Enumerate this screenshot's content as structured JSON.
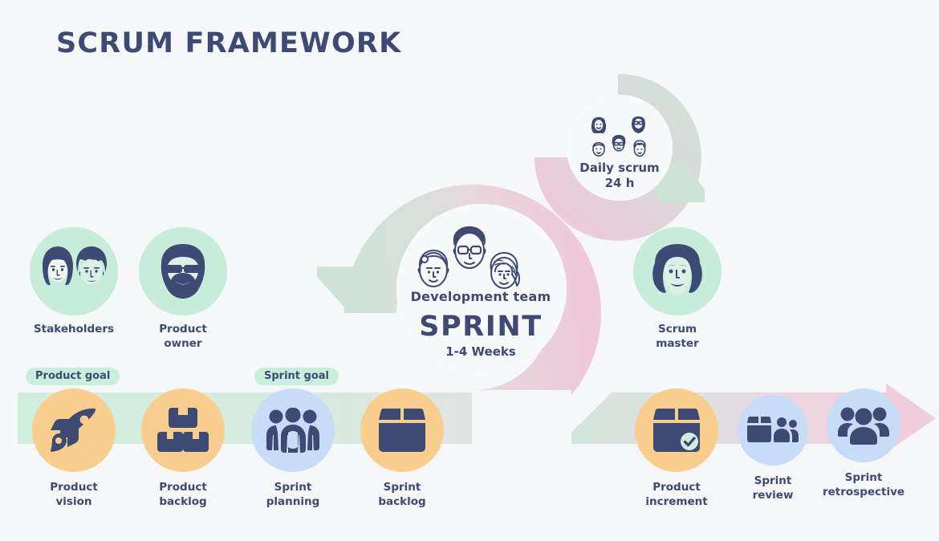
{
  "page": {
    "title": "SCRUM FRAMEWORK",
    "background_color": "#f6f7f9",
    "ink_color": "#3d4a73"
  },
  "palette": {
    "navy": "#3d4a73",
    "mint": "#c7ecd9",
    "mint_band": "#cfeede",
    "mint_badge": "#c8eedc",
    "orange": "#f8cd8d",
    "blue": "#c6dcf7",
    "pink": "#f0cddb",
    "pink_ring": "#efcbd9",
    "mint_ring": "#cfe2d7",
    "white": "#f8f9fa"
  },
  "roles": [
    {
      "id": "stakeholders",
      "label": "Stakeholders",
      "icon": "two-faces-icon",
      "circle_color": "#c7ecd9"
    },
    {
      "id": "product-owner",
      "label": "Product\nowner",
      "icon": "bearded-face-icon",
      "circle_color": "#c7ecd9"
    },
    {
      "id": "scrum-master",
      "label": "Scrum\nmaster",
      "icon": "woman-face-icon",
      "circle_color": "#c7ecd9"
    }
  ],
  "center": {
    "team_label": "Development team",
    "sprint_label": "SPRINT",
    "duration_label": "1-4 Weeks",
    "icon": "three-faces-line-icon"
  },
  "daily": {
    "label": "Daily scrum\n24 h",
    "icon": "five-faces-line-icon"
  },
  "badges": [
    {
      "id": "product-goal",
      "label": "Product goal",
      "color": "#c8eedc"
    },
    {
      "id": "sprint-goal",
      "label": "Sprint goal",
      "color": "#c8eedc"
    }
  ],
  "artifacts": [
    {
      "id": "product-vision",
      "label": "Product\nvision",
      "icon": "rocket-icon",
      "circle_color": "#f8cd8d"
    },
    {
      "id": "product-backlog",
      "label": "Product\nbacklog",
      "icon": "stacked-boxes-icon",
      "circle_color": "#f8cd8d"
    },
    {
      "id": "sprint-planning",
      "label": "Sprint\nplanning",
      "icon": "people-group-icon",
      "circle_color": "#c6dcf7"
    },
    {
      "id": "sprint-backlog",
      "label": "Sprint\nbacklog",
      "icon": "open-box-icon",
      "circle_color": "#f8cd8d"
    },
    {
      "id": "product-increment",
      "label": "Product\nincrement",
      "icon": "box-check-icon",
      "circle_color": "#f8cd8d"
    },
    {
      "id": "sprint-review",
      "label": "Sprint\nreview",
      "icon": "box-people-icon",
      "circle_color": "#c6dcf7"
    },
    {
      "id": "sprint-retrospective",
      "label": "Sprint\nretrospective",
      "icon": "three-people-icon",
      "circle_color": "#c6dcf7"
    }
  ],
  "flow": {
    "band_label": "",
    "arrow_head_color": "#f0cddb",
    "band_left_color": "#cfeede",
    "band_right_color": "#cfe2d7"
  }
}
